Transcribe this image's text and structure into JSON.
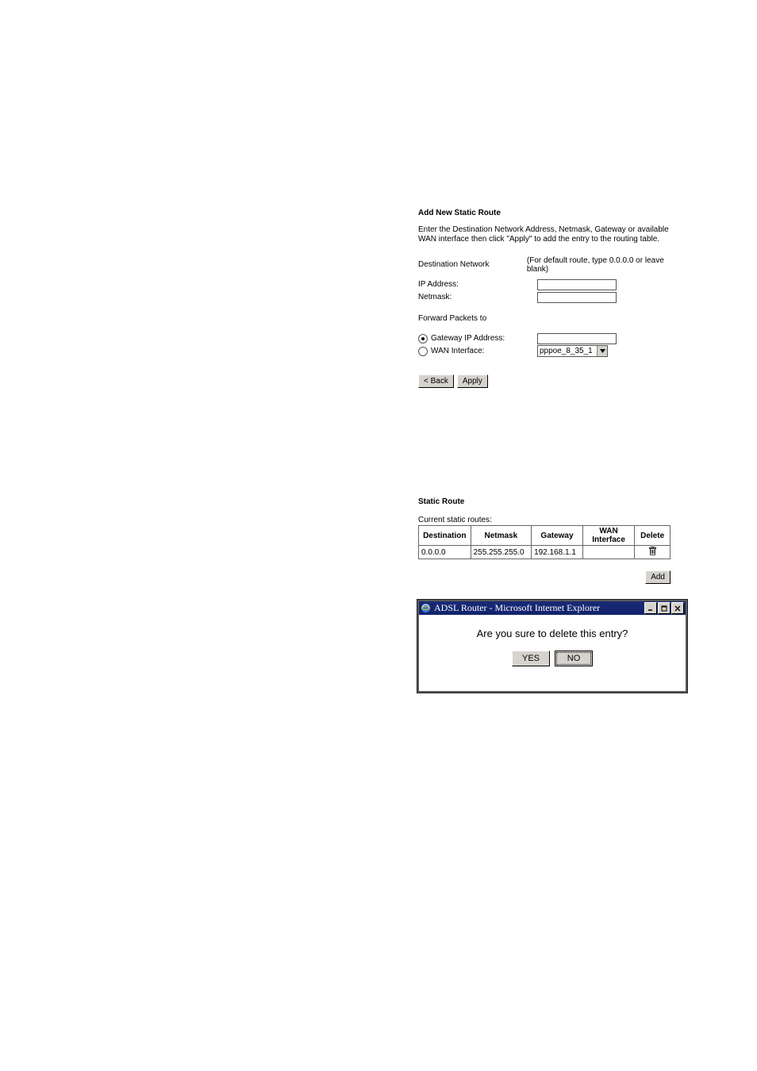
{
  "panel1": {
    "heading": "Add New Static Route",
    "intro": "Enter the Destination Network Address, Netmask, Gateway or available WAN interface then click \"Apply\" to add the entry to the routing table.",
    "dest_label": "Destination Network",
    "dest_hint": "(For default route, type 0.0.0.0 or leave blank)",
    "ip_label": "IP Address:",
    "ip_value": "",
    "netmask_label": "Netmask:",
    "netmask_value": "",
    "forward_label": "Forward Packets to",
    "gw_radio_label": "Gateway IP Address:",
    "gw_value": "",
    "wan_radio_label": "WAN Interface:",
    "wan_selected": "pppoe_8_35_1",
    "back_btn": "< Back",
    "apply_btn": "Apply"
  },
  "panel2": {
    "heading": "Static Route",
    "caption": "Current static routes:",
    "headers": {
      "dest": "Destination",
      "netmask": "Netmask",
      "gateway": "Gateway",
      "wan": "WAN Interface",
      "delete": "Delete"
    },
    "row": {
      "dest": "0.0.0.0",
      "netmask": "255.255.255.0",
      "gateway": "192.168.1.1",
      "wan": ""
    },
    "add_btn": "Add"
  },
  "panel3": {
    "title": "ADSL Router - Microsoft Internet Explorer",
    "message": "Are you sure to delete this entry?",
    "yes": "YES",
    "no": "NO"
  }
}
